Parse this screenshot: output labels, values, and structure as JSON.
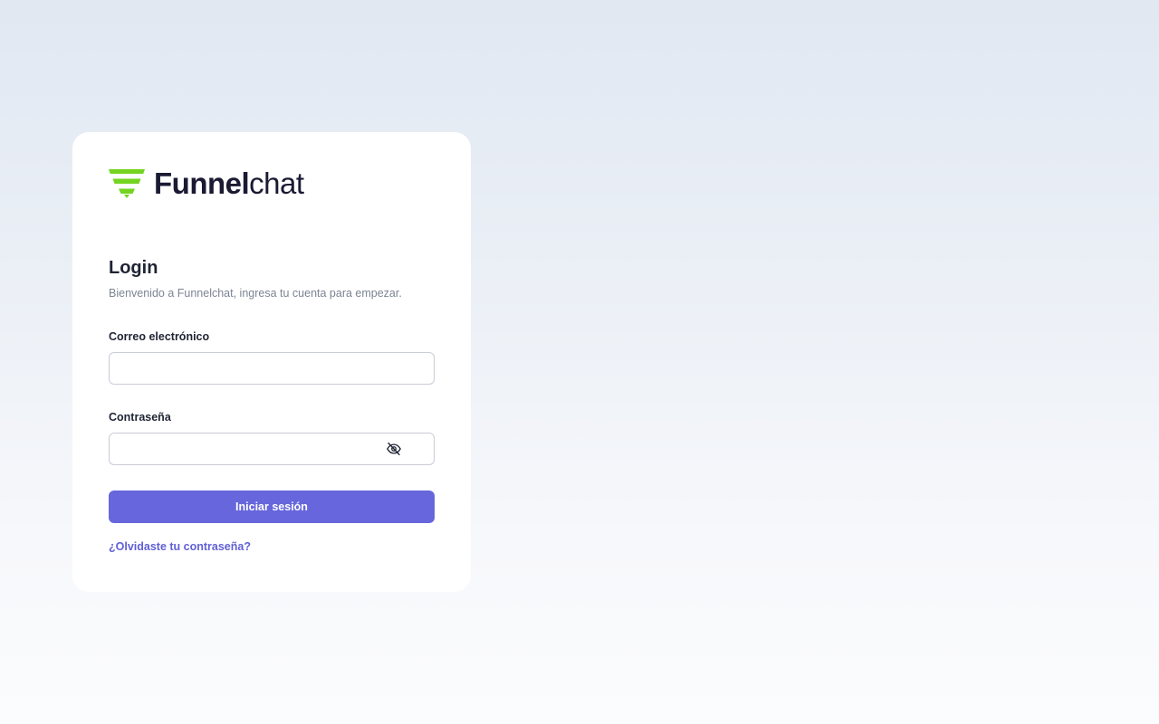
{
  "brand": {
    "name_bold": "Funnel",
    "name_light": "chat",
    "logo_icon": "funnel-logo-icon",
    "logo_color": "#74d420",
    "text_color": "#1b1a33"
  },
  "login": {
    "title": "Login",
    "subtitle": "Bienvenido a Funnelchat, ingresa tu cuenta para empezar.",
    "email_label": "Correo electrónico",
    "email_value": "",
    "password_label": "Contraseña",
    "password_value": "",
    "password_toggle_icon": "eye-off-icon",
    "submit_label": "Iniciar sesión",
    "forgot_label": "¿Olvidaste tu contraseña?"
  },
  "colors": {
    "accent": "#6766dc",
    "link": "#6160d6"
  }
}
